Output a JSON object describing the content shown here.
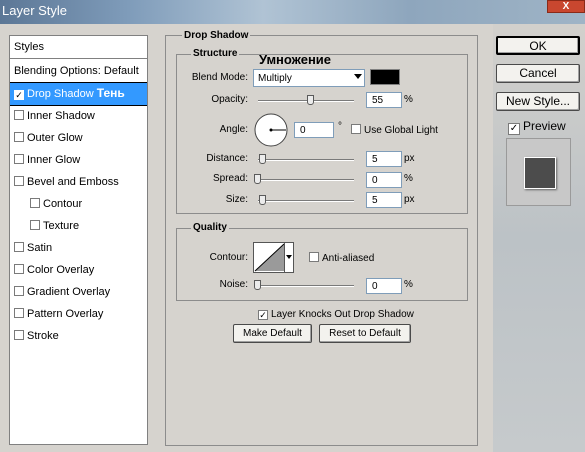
{
  "window": {
    "title": "Layer Style",
    "close_label": "X"
  },
  "styles": {
    "header": "Styles",
    "blending_options": "Blending Options: Default",
    "items": [
      {
        "label": "Drop Shadow",
        "checked": true,
        "selected": true,
        "annotation": "Тень"
      },
      {
        "label": "Inner Shadow",
        "checked": false
      },
      {
        "label": "Outer Glow",
        "checked": false
      },
      {
        "label": "Inner Glow",
        "checked": false
      },
      {
        "label": "Bevel and Emboss",
        "checked": false
      },
      {
        "label": "Contour",
        "checked": false
      },
      {
        "label": "Texture",
        "checked": false
      },
      {
        "label": "Satin",
        "checked": false
      },
      {
        "label": "Color Overlay",
        "checked": false
      },
      {
        "label": "Gradient Overlay",
        "checked": false
      },
      {
        "label": "Pattern Overlay",
        "checked": false
      },
      {
        "label": "Stroke",
        "checked": false
      }
    ]
  },
  "drop_shadow": {
    "panel_title": "Drop Shadow",
    "structure": {
      "title": "Structure",
      "annotation": "Умножение",
      "blend_mode_label": "Blend Mode:",
      "blend_mode_value": "Multiply",
      "shadow_color": "#000000",
      "opacity_label": "Opacity:",
      "opacity_value": "55",
      "opacity_unit": "%",
      "angle_label": "Angle:",
      "angle_value": "0",
      "angle_unit": "°",
      "use_global_light_label": "Use Global Light",
      "use_global_light": false,
      "distance_label": "Distance:",
      "distance_value": "5",
      "distance_unit": "px",
      "spread_label": "Spread:",
      "spread_value": "0",
      "spread_unit": "%",
      "size_label": "Size:",
      "size_value": "5",
      "size_unit": "px"
    },
    "quality": {
      "title": "Quality",
      "contour_label": "Contour:",
      "anti_aliased_label": "Anti-aliased",
      "anti_aliased": false,
      "noise_label": "Noise:",
      "noise_value": "0",
      "noise_unit": "%"
    },
    "knocks_out_label": "Layer Knocks Out Drop Shadow",
    "knocks_out": true,
    "make_default_label": "Make Default",
    "reset_default_label": "Reset to Default"
  },
  "actions": {
    "ok_label": "OK",
    "cancel_label": "Cancel",
    "new_style_label": "New Style...",
    "preview_label": "Preview",
    "preview_checked": true
  }
}
